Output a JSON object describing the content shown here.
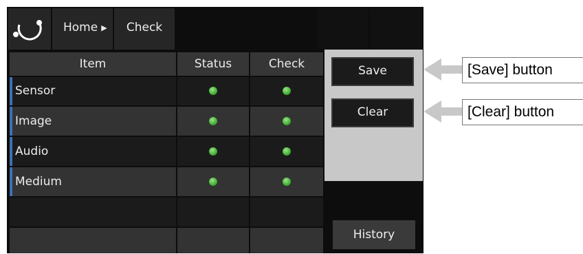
{
  "header": {
    "breadcrumb": [
      {
        "label": "Home"
      },
      {
        "label": "Check"
      }
    ]
  },
  "table": {
    "columns": [
      "Item",
      "Status",
      "Check"
    ],
    "rows": [
      {
        "item": "Sensor",
        "status": "ok",
        "check": "ok"
      },
      {
        "item": "Image",
        "status": "ok",
        "check": "ok"
      },
      {
        "item": "Audio",
        "status": "ok",
        "check": "ok"
      },
      {
        "item": "Medium",
        "status": "ok",
        "check": "ok"
      }
    ],
    "status_color": "#47b53a",
    "accent_color": "#3e6fb4"
  },
  "side": {
    "save_label": "Save",
    "clear_label": "Clear",
    "history_label": "History"
  },
  "annotations": {
    "save": "[Save] button",
    "clear": "[Clear] button"
  }
}
